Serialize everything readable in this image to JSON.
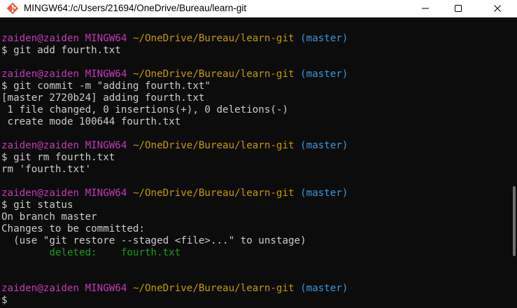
{
  "window": {
    "title": "MINGW64:/c/Users/21694/OneDrive/Bureau/learn-git",
    "icon": "git-bash-icon",
    "controls": [
      "minimize-icon",
      "maximize-icon",
      "close-icon"
    ]
  },
  "prompt": {
    "user_host": "zaiden@zaiden",
    "shell": "MINGW64",
    "path": "~/OneDrive/Bureau/learn-git",
    "branch": "(master)",
    "symbol": "$"
  },
  "lines": {
    "cmd1": "$ git add fourth.txt",
    "cmd2": "$ git commit -m \"adding fourth.txt\"",
    "out2_1": "[master 2720b24] adding fourth.txt",
    "out2_2": " 1 file changed, 0 insertions(+), 0 deletions(-)",
    "out2_3": " create mode 100644 fourth.txt",
    "cmd3": "$ git rm fourth.txt",
    "out3_1": "rm 'fourth.txt'",
    "cmd4": "$ git status",
    "out4_1": "On branch master",
    "out4_2": "Changes to be committed:",
    "out4_3": "  (use \"git restore --staged <file>...\" to unstage)",
    "out4_4": "        deleted:    fourth.txt",
    "cmd5": "$"
  },
  "colors": {
    "background": "#0c0c0c",
    "text": "#cccccc",
    "user_host": "#c13ab7",
    "path": "#c19c00",
    "branch": "#3a96dd",
    "deleted": "#13a10e"
  }
}
